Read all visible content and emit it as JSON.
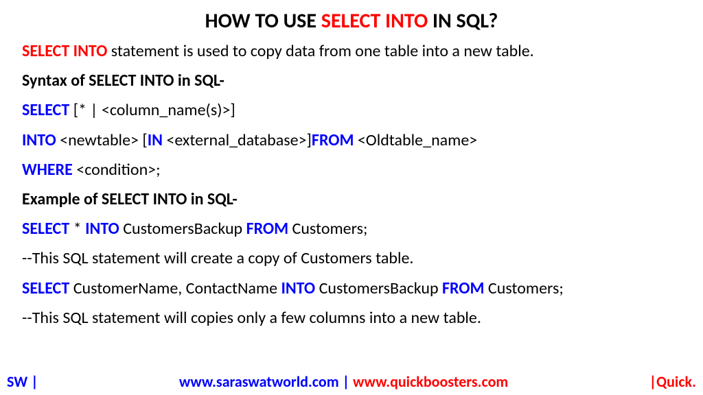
{
  "title": {
    "pre": "HOW TO USE ",
    "red": "SELECT INTO",
    "post": " IN SQL?"
  },
  "intro": {
    "red": "SELECT INTO",
    "rest": " statement is used to copy data from one table into a new table."
  },
  "syntaxHeading": "Syntax of SELECT INTO in SQL-",
  "syntax1": {
    "kw": "SELECT",
    "rest": " [* | <column_name(s)>]"
  },
  "syntax2": {
    "kw1": "INTO",
    "t1": " <newtable> [",
    "kw2": "IN",
    "t2": " <external_database>]",
    "kw3": "FROM",
    "t3": " <Oldtable_name>"
  },
  "syntax3": {
    "kw": "WHERE",
    "rest": " <condition>;"
  },
  "exampleHeading": "Example of SELECT INTO in SQL-",
  "ex1": {
    "kw1": "SELECT",
    "t1": " * ",
    "kw2": "INTO",
    "t2": " CustomersBackup ",
    "kw3": "FROM",
    "t3": " Customers;"
  },
  "ex1comment": "--This SQL statement will create a copy of Customers table.",
  "ex2": {
    "kw1": "SELECT",
    "t1": " CustomerName, ContactName ",
    "kw2": "INTO",
    "t2": " CustomersBackup ",
    "kw3": "FROM",
    "t3": " Customers;"
  },
  "ex2comment": "--This SQL statement will copies only a few columns into a new table.",
  "footer": {
    "left": "SW |",
    "centerBlue": "www.saraswatworld.com | ",
    "centerRed": "www.quickboosters.com",
    "right": "|Quick."
  }
}
